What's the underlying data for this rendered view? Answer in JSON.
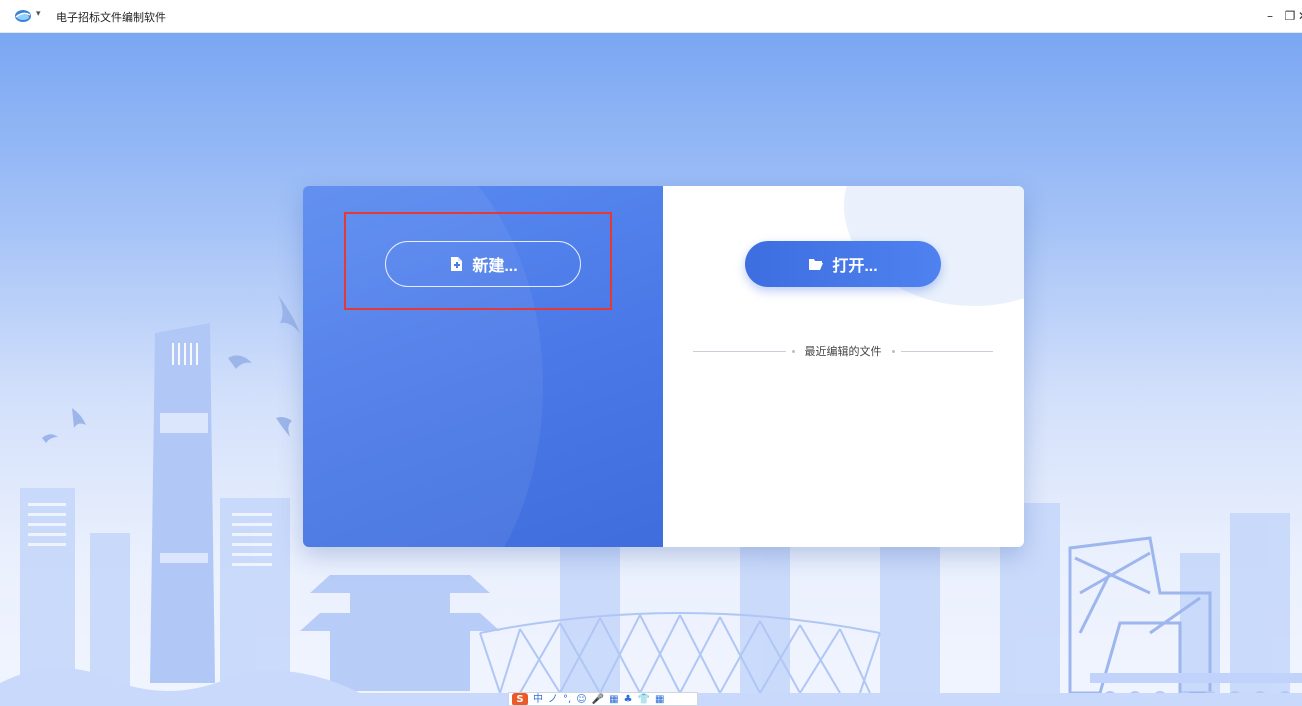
{
  "window": {
    "title": "电子招标文件编制软件",
    "menu_caret": "▾",
    "minimize": "–",
    "restore": "❐",
    "close": "✕"
  },
  "actions": {
    "new_label": "新建...",
    "open_label": "打开..."
  },
  "recent": {
    "label": "最近编辑的文件"
  },
  "ime": {
    "logo": "S",
    "mode": "中",
    "items": [
      "ノ",
      "°,",
      "☺",
      "🎤",
      "▦",
      "♣",
      "👕",
      "▦"
    ]
  },
  "colors": {
    "accent": "#4b7ae8",
    "highlight": "#e53935"
  }
}
